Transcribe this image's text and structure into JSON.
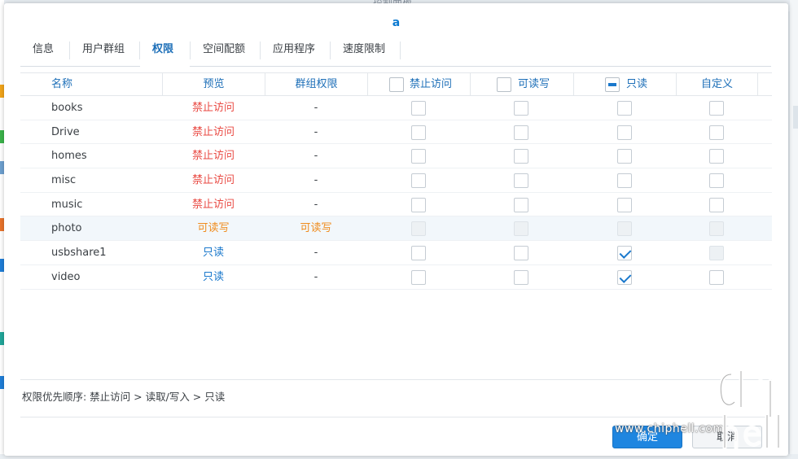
{
  "background": {
    "title": "控制面板"
  },
  "dialog": {
    "title": "a",
    "tabs": [
      {
        "label": "信息"
      },
      {
        "label": "用户群组"
      },
      {
        "label": "权限"
      },
      {
        "label": "空间配额"
      },
      {
        "label": "应用程序"
      },
      {
        "label": "速度限制"
      }
    ],
    "active_tab": "权限",
    "table": {
      "headers": {
        "name": "名称",
        "preview": "预览",
        "group": "群组权限",
        "deny": "禁止访问",
        "rw": "可读写",
        "ro": "只读",
        "custom": "自定义"
      },
      "header_checkbox_state": {
        "deny": "unchecked",
        "rw": "unchecked",
        "ro": "indeterminate"
      },
      "rows": [
        {
          "name": "books",
          "preview": "禁止访问",
          "group": "-"
        },
        {
          "name": "Drive",
          "preview": "禁止访问",
          "group": "-"
        },
        {
          "name": "homes",
          "preview": "禁止访问",
          "group": "-"
        },
        {
          "name": "misc",
          "preview": "禁止访问",
          "group": "-"
        },
        {
          "name": "music",
          "preview": "禁止访问",
          "group": "-"
        },
        {
          "name": "photo",
          "preview": "可读写",
          "group": "可读写"
        },
        {
          "name": "usbshare1",
          "preview": "只读",
          "group": "-"
        },
        {
          "name": "video",
          "preview": "只读",
          "group": "-"
        }
      ]
    },
    "priority_text": "权限优先顺序: 禁止访问 > 读取/写入 > 只读",
    "buttons": {
      "ok": "确定",
      "cancel": "取消"
    }
  },
  "watermark": {
    "url": "www.chiphell.com",
    "logo": "chip hell"
  },
  "colors": {
    "accent": "#1d6fb8",
    "deny": "#e94a43",
    "read_write": "#f08c1e",
    "read_only": "#1a78cc",
    "primary_button": "#1f86e0"
  }
}
